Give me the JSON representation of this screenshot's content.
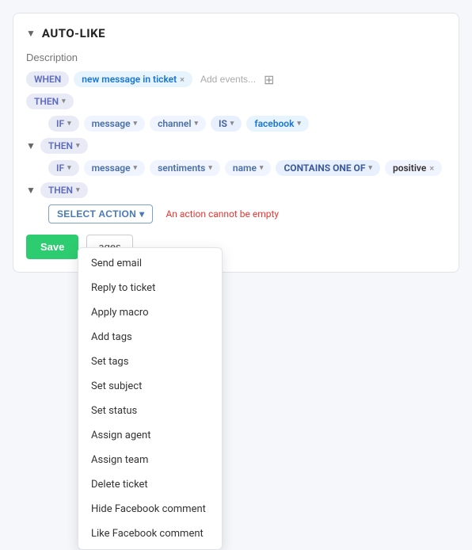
{
  "header": {
    "chevron": "▼",
    "title": "AUTO-LIKE"
  },
  "description": {
    "placeholder": "Description"
  },
  "when_row": {
    "when_label": "WHEN",
    "event_label": "new message in ticket",
    "add_events_placeholder": "Add events...",
    "calendar_icon": "📋"
  },
  "then_row": {
    "then_label": "THEN",
    "caret": "▾"
  },
  "if_row_1": {
    "if_label": "IF",
    "if_caret": "▾",
    "field1": "message",
    "field1_caret": "▾",
    "field2": "channel",
    "field2_caret": "▾",
    "operator": "IS",
    "operator_caret": "▾",
    "value": "facebook",
    "value_caret": "▾"
  },
  "then_row_2": {
    "then_label": "THEN",
    "caret": "▾",
    "chevron": "▼"
  },
  "if_row_2": {
    "if_label": "IF",
    "if_caret": "▾",
    "field1": "message",
    "field1_caret": "▾",
    "field2": "sentiments",
    "field2_caret": "▾",
    "field3": "name",
    "field3_caret": "▾",
    "operator": "CONTAINS ONE OF",
    "operator_caret": "▾",
    "value": "positive",
    "chevron": "▼"
  },
  "then_row_3": {
    "then_label": "THEN",
    "caret": "▾"
  },
  "select_action": {
    "label": "SELECT ACTION",
    "caret": "▾",
    "error": "An action cannot be empty"
  },
  "dropdown": {
    "items": [
      "Send email",
      "Reply to ticket",
      "Apply macro",
      "Add tags",
      "Set tags",
      "Set subject",
      "Set status",
      "Assign agent",
      "Assign team",
      "Delete ticket",
      "Hide Facebook comment",
      "Like Facebook comment"
    ]
  },
  "bottom": {
    "save_label": "Save",
    "manage_label": "ages"
  }
}
